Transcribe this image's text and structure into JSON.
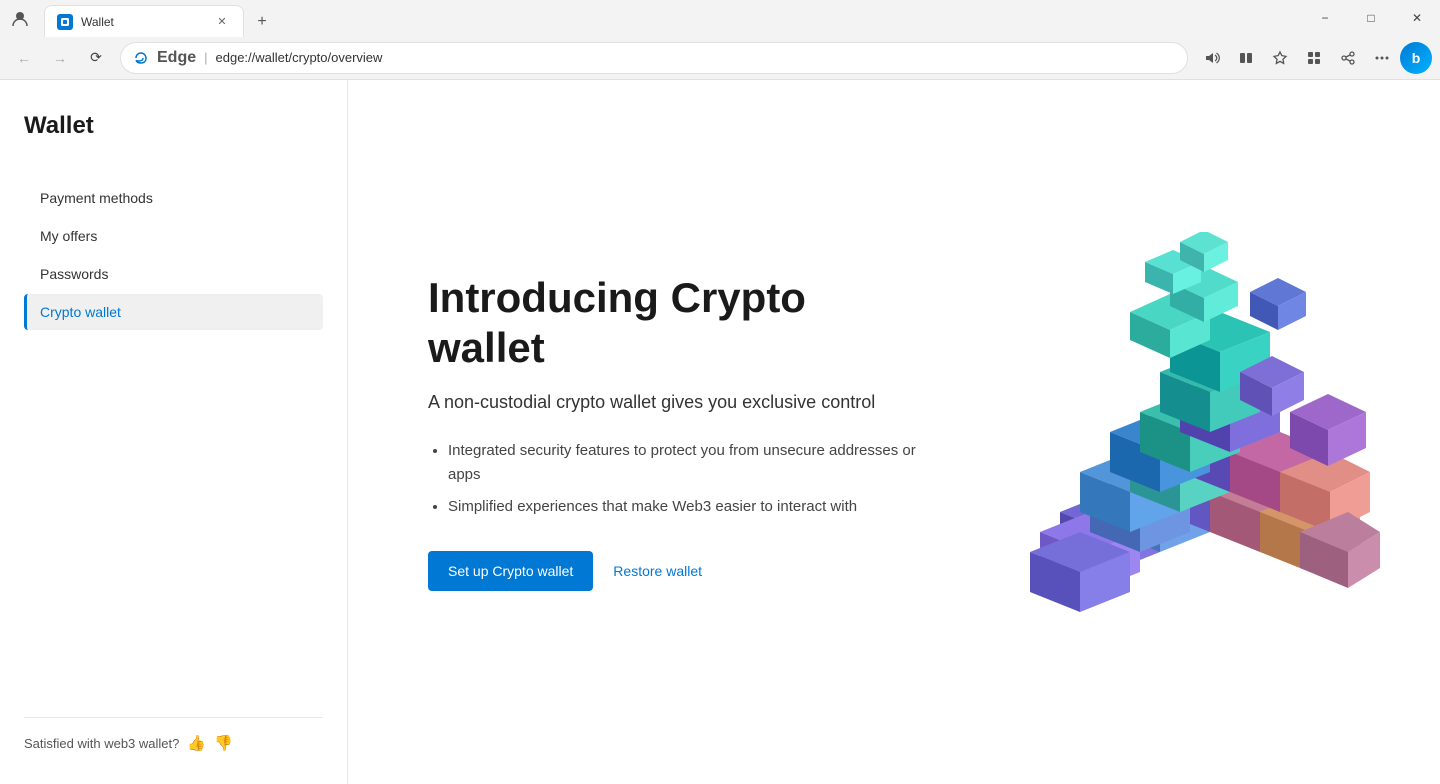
{
  "browser": {
    "tab_title": "Wallet",
    "address_brand": "Edge",
    "address_separator": "|",
    "address_url": "edge://wallet/crypto/overview",
    "new_tab_label": "+"
  },
  "window_controls": {
    "minimize": "−",
    "maximize": "□",
    "close": "✕"
  },
  "sidebar": {
    "title": "Wallet",
    "nav_items": [
      {
        "label": "Payment methods",
        "id": "payment-methods",
        "active": false
      },
      {
        "label": "My offers",
        "id": "my-offers",
        "active": false
      },
      {
        "label": "Passwords",
        "id": "passwords",
        "active": false
      },
      {
        "label": "Crypto wallet",
        "id": "crypto-wallet",
        "active": true
      }
    ],
    "feedback": {
      "text": "Satisfied with web3 wallet?"
    }
  },
  "main": {
    "title": "Introducing Crypto wallet",
    "subtitle": "A non-custodial crypto wallet gives you exclusive control",
    "features": [
      "Integrated security features to protect you from unsecure addresses or apps",
      "Simplified experiences that make Web3 easier to interact with"
    ],
    "setup_button": "Set up Crypto wallet",
    "restore_link": "Restore wallet"
  }
}
